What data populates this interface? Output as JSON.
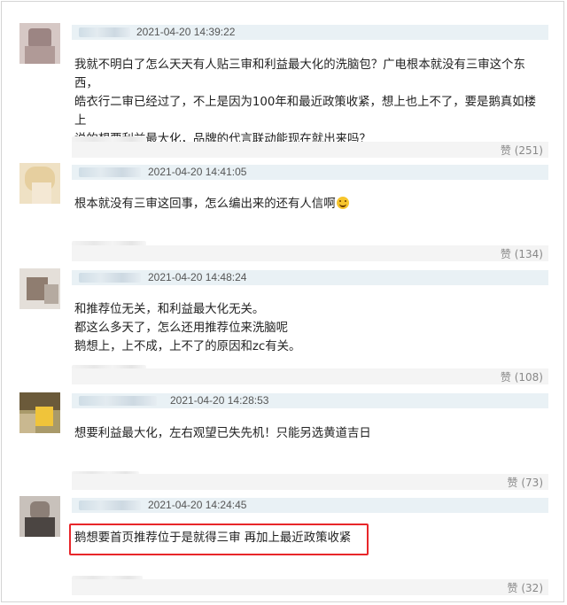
{
  "comments": [
    {
      "time": "2021-04-20 14:39:22",
      "lines": [
        "我就不明白了怎么天天有人贴三审和利益最大化的洗脑包？广电根本就没有三审这个东西，",
        "皓衣行二审已经过了，不上是因为100年和最近政策收紧，想上也上不了，要是鹅真如楼上",
        "说的想要利益最大化，品牌的代言联动能现在就出来吗？"
      ],
      "likes": "赞 (251)"
    },
    {
      "time": "2021-04-20 14:41:05",
      "lines": [
        "根本就没有三审这回事，怎么编出来的还有人信啊"
      ],
      "emoji": "laughing-tears-emoji",
      "likes": "赞 (134)"
    },
    {
      "time": "2021-04-20 14:48:24",
      "lines": [
        "和推荐位无关，和利益最大化无关。",
        "都这么多天了，怎么还用推荐位来洗脑呢",
        "鹅想上，上不成，上不了的原因和zc有关。"
      ],
      "likes": "赞 (108)"
    },
    {
      "time": "2021-04-20 14:28:53",
      "lines": [
        "想要利益最大化，左右观望已失先机！只能另选黄道吉日"
      ],
      "likes": "赞 (73)"
    },
    {
      "time": "2021-04-20 14:24:45",
      "lines": [
        "鹅想要首页推荐位于是就得三审 再加上最近政策收紧"
      ],
      "likes": "赞 (32)"
    }
  ],
  "colors": {
    "highlight_border": "#e8262a",
    "name_bar": "#e9f1f5",
    "like_text": "#888888"
  }
}
